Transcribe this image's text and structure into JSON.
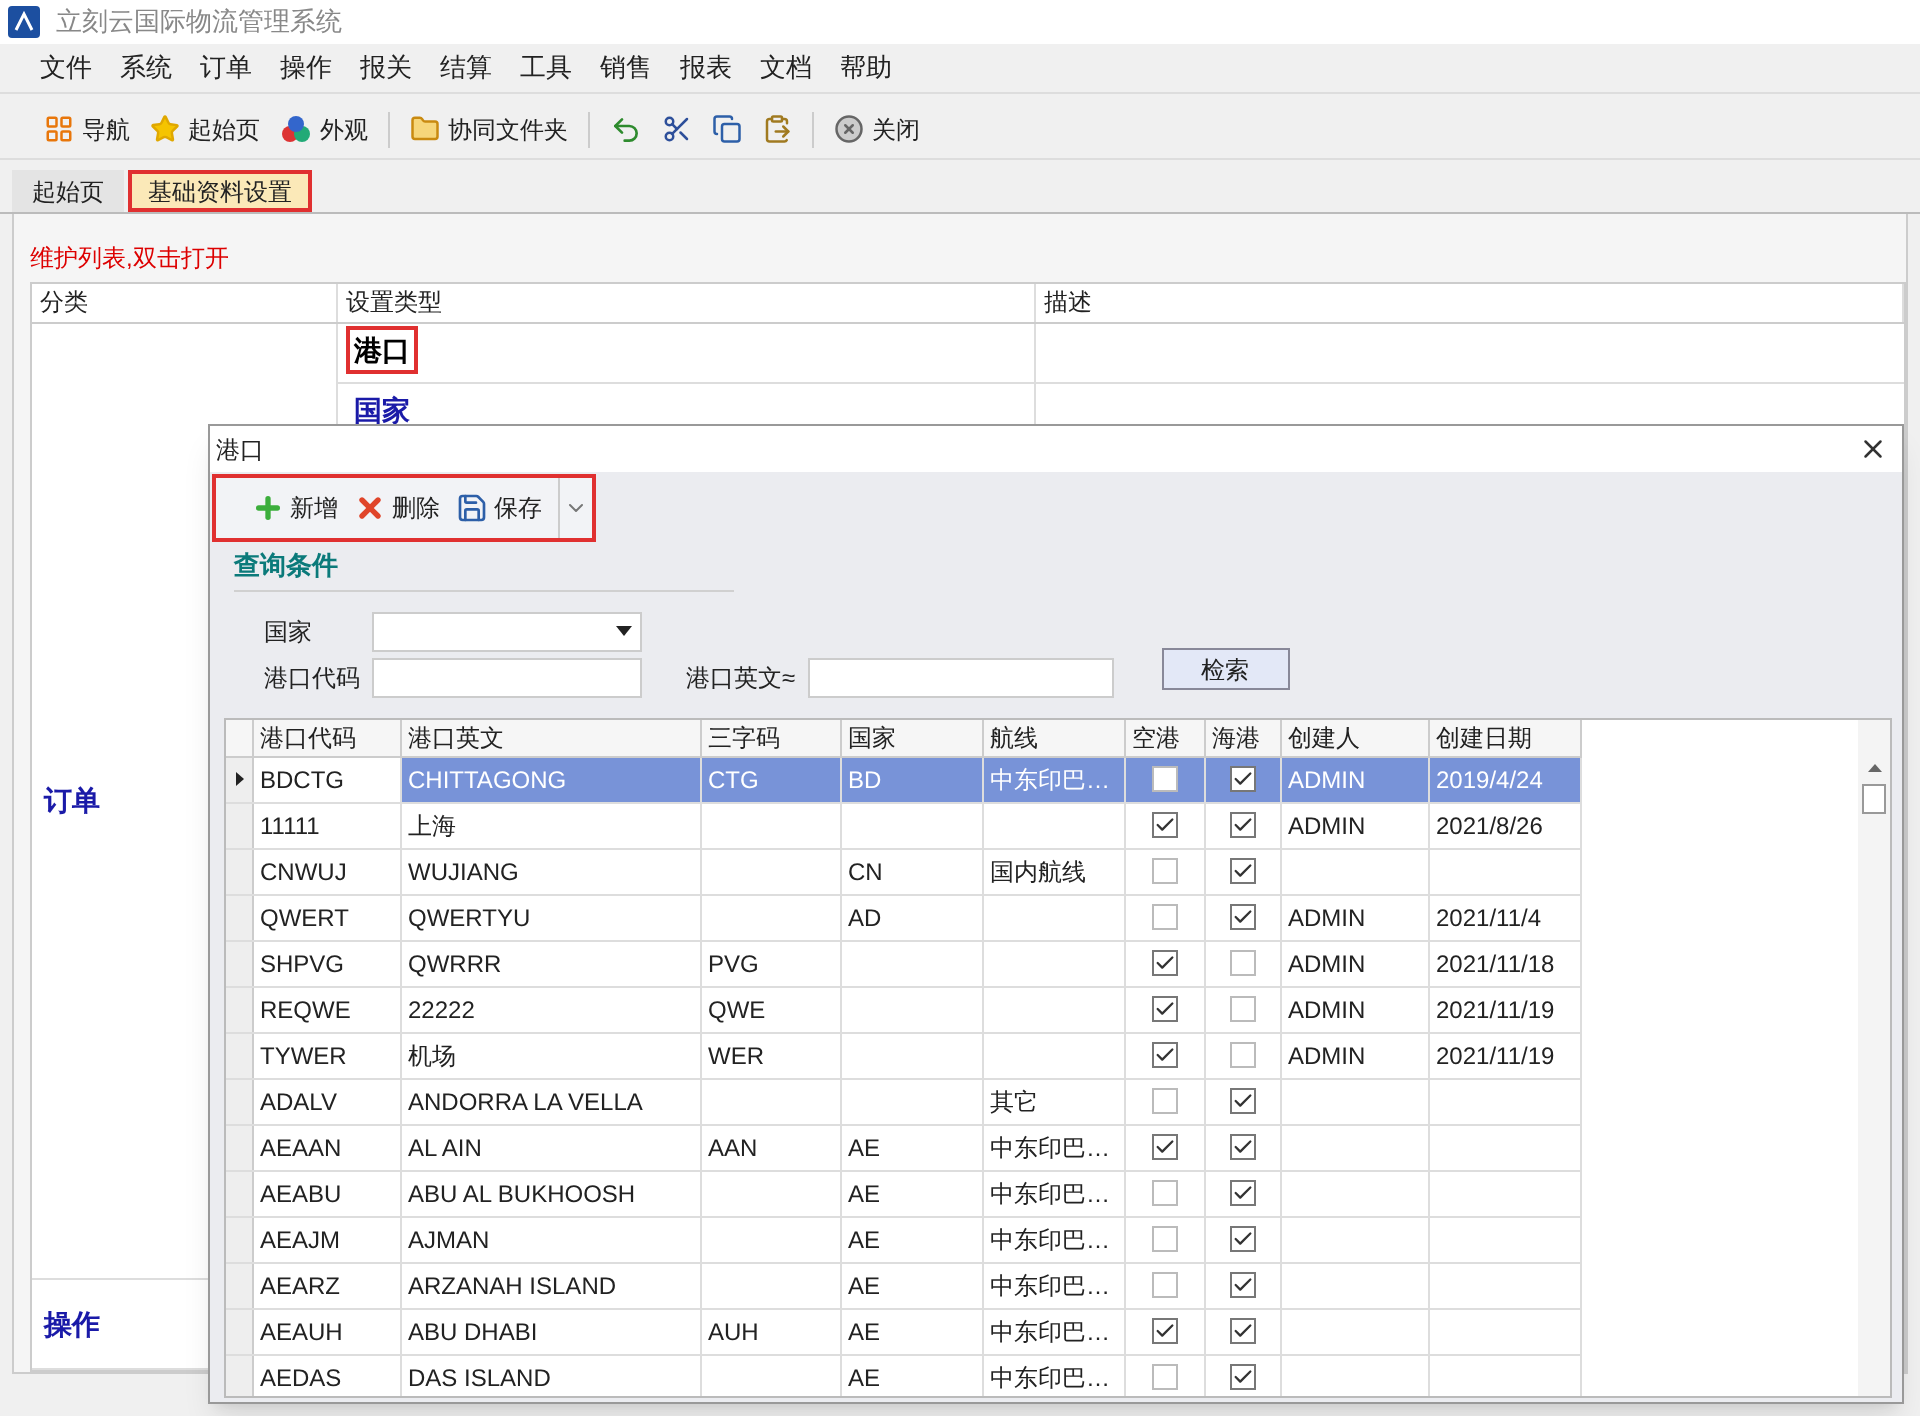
{
  "app": {
    "title": "立刻云国际物流管理系统"
  },
  "menu": [
    "文件",
    "系统",
    "订单",
    "操作",
    "报关",
    "结算",
    "工具",
    "销售",
    "报表",
    "文档",
    "帮助"
  ],
  "toolbar": [
    {
      "kind": "nav",
      "label": "导航"
    },
    {
      "kind": "star",
      "label": "起始页"
    },
    {
      "kind": "skin",
      "label": "外观"
    },
    {
      "kind": "sep"
    },
    {
      "kind": "folder",
      "label": "协同文件夹"
    },
    {
      "kind": "sep"
    },
    {
      "kind": "undo"
    },
    {
      "kind": "cut"
    },
    {
      "kind": "copy"
    },
    {
      "kind": "paste"
    },
    {
      "kind": "sep"
    },
    {
      "kind": "close",
      "label": "关闭"
    }
  ],
  "tabs": [
    {
      "label": "起始页",
      "selected": false,
      "highlighted": false
    },
    {
      "label": "基础资料设置",
      "selected": true,
      "highlighted": true
    }
  ],
  "hint": "维护列表,双击打开",
  "settings_table": {
    "columns": [
      "分类",
      "设置类型",
      "描述"
    ],
    "rows": [
      {
        "type": "港口",
        "selected": true,
        "highlighted": true
      },
      {
        "type": "国家",
        "selected": false,
        "highlighted": false
      }
    ],
    "categories": [
      "订单",
      "操作"
    ]
  },
  "dialog": {
    "title": "港口",
    "toolbar": {
      "highlighted": true,
      "buttons": [
        {
          "kind": "add",
          "label": "新增"
        },
        {
          "kind": "delete",
          "label": "删除"
        },
        {
          "kind": "save",
          "label": "保存"
        }
      ]
    },
    "query_title": "查询条件",
    "country_label": "国家",
    "code_label": "港口代码",
    "english_label": "港口英文≈",
    "search_button": "检索",
    "columns": [
      "港口代码",
      "港口英文",
      "三字码",
      "国家",
      "航线",
      "空港",
      "海港",
      "创建人",
      "创建日期"
    ],
    "rows": [
      {
        "selected": true,
        "code": "BDCTG",
        "english": "CHITTAGONG",
        "iata": "CTG",
        "country": "BD",
        "route": "中东印巴…",
        "air": false,
        "sea": true,
        "creator": "ADMIN",
        "date": "2019/4/24"
      },
      {
        "selected": false,
        "code": "11111",
        "english": "上海",
        "iata": "",
        "country": "",
        "route": "",
        "air": true,
        "sea": true,
        "creator": "ADMIN",
        "date": "2021/8/26"
      },
      {
        "selected": false,
        "code": "CNWUJ",
        "english": "WUJIANG",
        "iata": "",
        "country": "CN",
        "route": "国内航线",
        "air": false,
        "sea": true,
        "creator": "",
        "date": ""
      },
      {
        "selected": false,
        "code": "QWERT",
        "english": "QWERTYU",
        "iata": "",
        "country": "AD",
        "route": "",
        "air": false,
        "sea": true,
        "creator": "ADMIN",
        "date": "2021/11/4"
      },
      {
        "selected": false,
        "code": "SHPVG",
        "english": "QWRRR",
        "iata": "PVG",
        "country": "",
        "route": "",
        "air": true,
        "sea": false,
        "creator": "ADMIN",
        "date": "2021/11/18"
      },
      {
        "selected": false,
        "code": "REQWE",
        "english": "22222",
        "iata": "QWE",
        "country": "",
        "route": "",
        "air": true,
        "sea": false,
        "creator": "ADMIN",
        "date": "2021/11/19"
      },
      {
        "selected": false,
        "code": "TYWER",
        "english": "机场",
        "iata": "WER",
        "country": "",
        "route": "",
        "air": true,
        "sea": false,
        "creator": "ADMIN",
        "date": "2021/11/19"
      },
      {
        "selected": false,
        "code": "ADALV",
        "english": "ANDORRA LA VELLA",
        "iata": "",
        "country": "",
        "route": "其它",
        "air": false,
        "sea": true,
        "creator": "",
        "date": ""
      },
      {
        "selected": false,
        "code": "AEAAN",
        "english": "AL AIN",
        "iata": "AAN",
        "country": "AE",
        "route": "中东印巴…",
        "air": true,
        "sea": true,
        "creator": "",
        "date": ""
      },
      {
        "selected": false,
        "code": "AEABU",
        "english": "ABU AL BUKHOOSH",
        "iata": "",
        "country": "AE",
        "route": "中东印巴…",
        "air": false,
        "sea": true,
        "creator": "",
        "date": ""
      },
      {
        "selected": false,
        "code": "AEAJM",
        "english": "AJMAN",
        "iata": "",
        "country": "AE",
        "route": "中东印巴…",
        "air": false,
        "sea": true,
        "creator": "",
        "date": ""
      },
      {
        "selected": false,
        "code": "AEARZ",
        "english": "ARZANAH ISLAND",
        "iata": "",
        "country": "AE",
        "route": "中东印巴…",
        "air": false,
        "sea": true,
        "creator": "",
        "date": ""
      },
      {
        "selected": false,
        "code": "AEAUH",
        "english": "ABU DHABI",
        "iata": "AUH",
        "country": "AE",
        "route": "中东印巴…",
        "air": true,
        "sea": true,
        "creator": "",
        "date": ""
      },
      {
        "selected": false,
        "code": "AEDAS",
        "english": "DAS ISLAND",
        "iata": "",
        "country": "AE",
        "route": "中东印巴…",
        "air": false,
        "sea": true,
        "creator": "",
        "date": ""
      }
    ]
  }
}
